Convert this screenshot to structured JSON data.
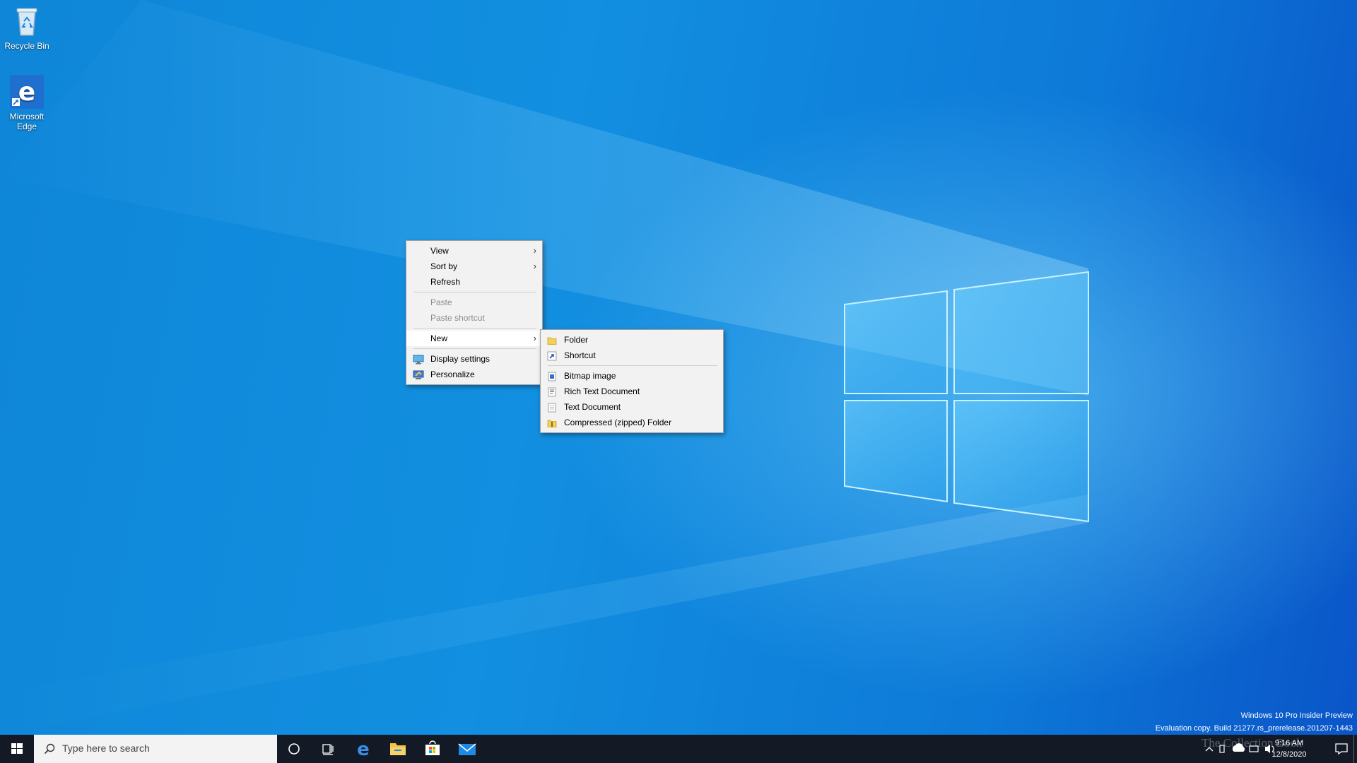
{
  "desktop": {
    "icons": [
      {
        "label": "Recycle Bin"
      },
      {
        "label": "Microsoft\nEdge"
      }
    ]
  },
  "context_menu": {
    "items": [
      {
        "label": "View",
        "has_submenu": true
      },
      {
        "label": "Sort by",
        "has_submenu": true
      },
      {
        "label": "Refresh"
      },
      {
        "label": "Paste",
        "disabled": true
      },
      {
        "label": "Paste shortcut",
        "disabled": true
      },
      {
        "label": "New",
        "has_submenu": true,
        "highlighted": true
      },
      {
        "label": "Display settings",
        "icon": "display-icon"
      },
      {
        "label": "Personalize",
        "icon": "personalize-icon"
      }
    ]
  },
  "new_submenu": {
    "items": [
      {
        "label": "Folder",
        "icon": "folder-icon"
      },
      {
        "label": "Shortcut",
        "icon": "shortcut-icon"
      },
      {
        "label": "Bitmap image",
        "icon": "bitmap-icon"
      },
      {
        "label": "Rich Text Document",
        "icon": "rtf-document-icon"
      },
      {
        "label": "Text Document",
        "icon": "text-document-icon"
      },
      {
        "label": "Compressed (zipped) Folder",
        "icon": "zip-folder-icon"
      }
    ]
  },
  "taskbar": {
    "search_placeholder": "Type here to search",
    "time": "9:16 AM",
    "date": "12/8/2020"
  },
  "watermark": {
    "line1": "Windows 10 Pro Insider Preview",
    "line2": "Evaluation copy. Build 21277.rs_prerelease.201207-1443"
  },
  "overlay_text": "The Collection Book",
  "colors": {
    "accent": "#0078d7",
    "taskbar": "#131a26",
    "menu_bg": "#f2f2f2"
  }
}
